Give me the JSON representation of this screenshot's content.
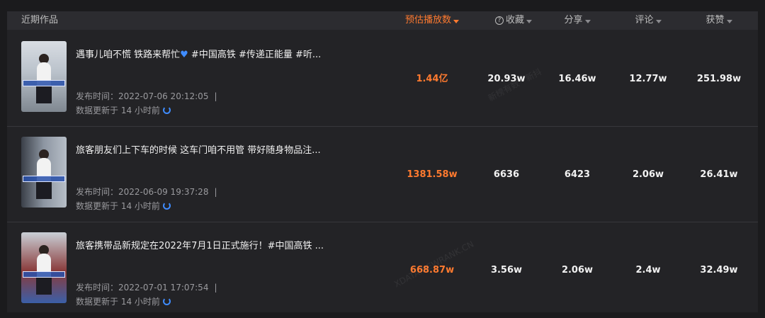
{
  "header": {
    "title": "近期作品",
    "columns": [
      "预估播放数",
      "收藏",
      "分享",
      "评论",
      "获赞"
    ]
  },
  "rows": [
    {
      "title_a": "遇事儿咱不慌 铁路来帮忙",
      "title_b": " #中国高铁 #传递正能量 #听...",
      "publish": "发布时间：2022-07-06 20:12:05",
      "updated": "数据更新于 14 小时前",
      "thumb_caption": "遇上这车怎么办",
      "plays": "1.44亿",
      "favorites": "20.93w",
      "shares": "16.46w",
      "comments": "12.77w",
      "likes": "251.98w"
    },
    {
      "title_a": "旅客朋友们上下车的时候 这车门咱不用管 带好随身物品注...",
      "title_b": "",
      "publish": "发布时间：2022-06-09 19:37:28",
      "updated": "数据更新于 14 小时前",
      "thumb_caption": "这车门你会开吗",
      "plays": "1381.58w",
      "favorites": "6636",
      "shares": "6423",
      "comments": "2.06w",
      "likes": "26.41w"
    },
    {
      "title_a": "旅客携带品新规定在2022年7月1日正式施行！#中国高铁 ...",
      "title_b": "",
      "publish": "发布时间：2022-07-01 17:07:54",
      "updated": "数据更新于 14 小时前",
      "thumb_caption": "旅客携带品新规定",
      "plays": "668.87w",
      "favorites": "3.56w",
      "shares": "2.06w",
      "comments": "2.4w",
      "likes": "32.49w"
    }
  ],
  "watermarks": [
    "新榜有数 · 新抖",
    "XDATA.NEWRANK.CN"
  ],
  "colors": {
    "accent": "#ff7a2f",
    "icon_blue": "#3f8cff",
    "background": "#232326"
  }
}
